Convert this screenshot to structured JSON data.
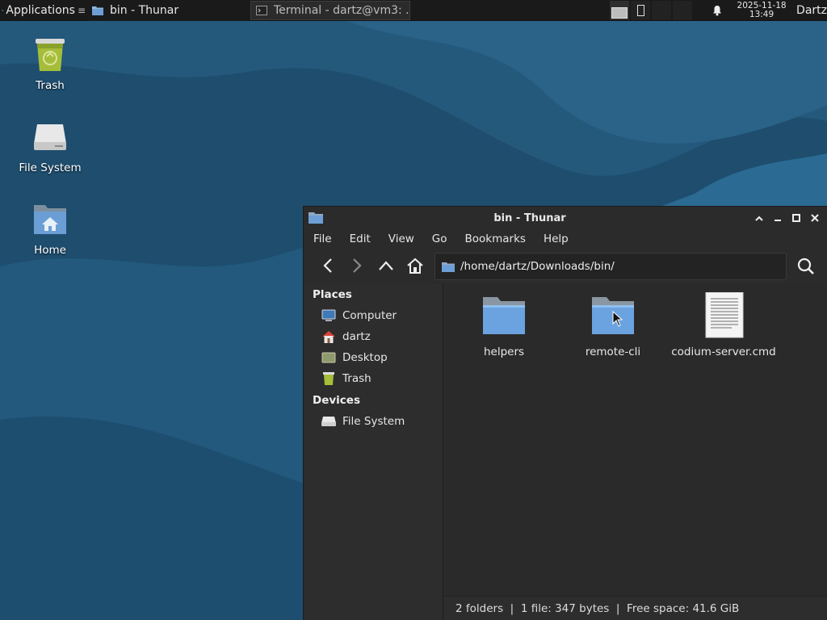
{
  "panel": {
    "applications_label": "Applications",
    "tasks": [
      {
        "label": "bin - Thunar",
        "icon": "folder-icon",
        "active": true
      },
      {
        "label": "Terminal - dartz@vm3: ...",
        "icon": "terminal-icon",
        "active": false
      }
    ],
    "clock_date": "2025-11-18",
    "clock_time": "13:49",
    "user": "Dartz"
  },
  "desktop": {
    "icons": [
      {
        "label": "Trash",
        "icon": "trash-icon"
      },
      {
        "label": "File System",
        "icon": "drive-icon"
      },
      {
        "label": "Home",
        "icon": "home-folder-icon"
      }
    ]
  },
  "window": {
    "title": "bin - Thunar",
    "menu": [
      "File",
      "Edit",
      "View",
      "Go",
      "Bookmarks",
      "Help"
    ],
    "location": "/home/dartz/Downloads/bin/",
    "sidebar": {
      "places_heading": "Places",
      "places": [
        {
          "label": "Computer",
          "icon": "computer-icon"
        },
        {
          "label": "dartz",
          "icon": "home-icon"
        },
        {
          "label": "Desktop",
          "icon": "desktop-icon"
        },
        {
          "label": "Trash",
          "icon": "trash-icon"
        }
      ],
      "devices_heading": "Devices",
      "devices": [
        {
          "label": "File System",
          "icon": "drive-icon"
        }
      ]
    },
    "files": [
      {
        "name": "helpers",
        "type": "folder"
      },
      {
        "name": "remote-cli",
        "type": "folder"
      },
      {
        "name": "codium-server.cmd",
        "type": "text-file"
      }
    ],
    "status": "2 folders  |  1 file: 347 bytes  |  Free space: 41.6 GiB"
  },
  "colors": {
    "wallpaper_dark": "#1b4766",
    "wallpaper_light": "#2b6489",
    "panel_bg": "#1a1a1a",
    "window_bg": "#2b2b2b",
    "folder_blue": "#6aa3e0"
  }
}
